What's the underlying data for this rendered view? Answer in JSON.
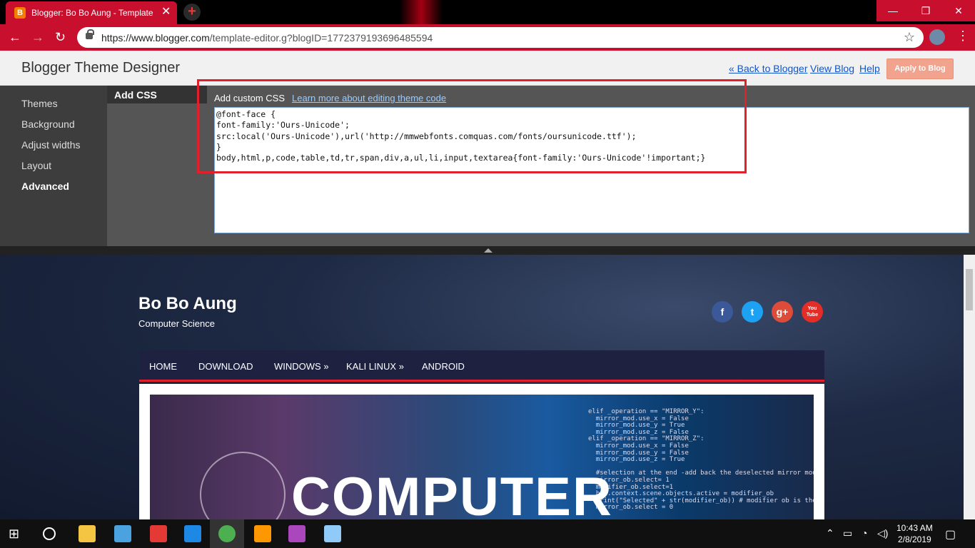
{
  "browser": {
    "tab_title": "Blogger: Bo Bo Aung - Template",
    "tab_close": "✕",
    "new_tab": "+",
    "url_host": "https://www.blogger.com",
    "url_path": "/template-editor.g?blogID=1772379193696485594",
    "window_controls": {
      "minimize": "—",
      "maximize": "❐",
      "close": "✕"
    },
    "nav": {
      "back": "←",
      "forward": "→",
      "reload": "↻"
    },
    "star": "☆",
    "menu": "⋮"
  },
  "designer": {
    "title": "Blogger Theme Designer",
    "links": {
      "back": "« Back to Blogger",
      "view_blog": "View Blog",
      "help": "Help"
    },
    "apply_button": "Apply to Blog",
    "sidebar": [
      {
        "label": "Themes"
      },
      {
        "label": "Background"
      },
      {
        "label": "Adjust widths"
      },
      {
        "label": "Layout"
      },
      {
        "label": "Advanced"
      }
    ],
    "sub_tab": "Add CSS",
    "editor": {
      "label": "Add custom CSS",
      "learn_link": "Learn more about editing theme code",
      "code": "@font-face {\nfont-family:'Ours-Unicode';\nsrc:local('Ours-Unicode'),url('http://mmwebfonts.comquas.com/fonts/oursunicode.ttf');\n}\nbody,html,p,code,table,td,tr,span,div,a,ul,li,input,textarea{font-family:'Ours-Unicode'!important;}"
    }
  },
  "blog": {
    "title": "Bo Bo Aung",
    "subtitle": "Computer Science",
    "social": [
      {
        "icon": "facebook-icon",
        "glyph": "f",
        "color": "#3b5998"
      },
      {
        "icon": "twitter-icon",
        "glyph": "t",
        "color": "#1da1f2"
      },
      {
        "icon": "google-plus-icon",
        "glyph": "g+",
        "color": "#dd4b39"
      },
      {
        "icon": "youtube-icon",
        "glyph": "You Tube",
        "color": "#e52d27"
      }
    ],
    "nav": [
      {
        "label": "HOME"
      },
      {
        "label": "DOWNLOAD"
      },
      {
        "label": "WINDOWS »"
      },
      {
        "label": "KALI LINUX »"
      },
      {
        "label": "ANDROID"
      }
    ],
    "banner_text": "COMPUTER",
    "banner_code": "elif _operation == \"MIRROR_Y\":\n  mirror_mod.use_x = False\n  mirror_mod.use_y = True\n  mirror_mod.use_z = False\nelif _operation == \"MIRROR_Z\":\n  mirror_mod.use_x = False\n  mirror_mod.use_y = False\n  mirror_mod.use_z = True\n\n  #selection at the end -add back the deselected mirror modifier\n  mirror_ob.select= 1\n  modifier_ob.select=1\n  bpy.context.scene.objects.active = modifier_ob\n  print(\"Selected\" + str(modifier_ob)) # modifier ob is the active ob\n  mirror_ob.select = 0"
  },
  "taskbar": {
    "time": "10:43 AM",
    "date": "2/8/2019",
    "apps": [
      {
        "icon": "windows-start-icon",
        "color": "#ffffff"
      },
      {
        "icon": "cortana-icon",
        "color": "#ffffff"
      },
      {
        "icon": "file-explorer-icon",
        "color": "#f4c542"
      },
      {
        "icon": "control-panel-icon",
        "color": "#4aa3df"
      },
      {
        "icon": "ccleaner-icon",
        "color": "#e53935"
      },
      {
        "icon": "edge-icon",
        "color": "#1e88e5"
      },
      {
        "icon": "chrome-icon",
        "color": "#4caf50"
      },
      {
        "icon": "sublime-icon",
        "color": "#ff9800"
      },
      {
        "icon": "picasa-icon",
        "color": "#ab47bc"
      },
      {
        "icon": "notepad-icon",
        "color": "#90caf9"
      }
    ]
  }
}
